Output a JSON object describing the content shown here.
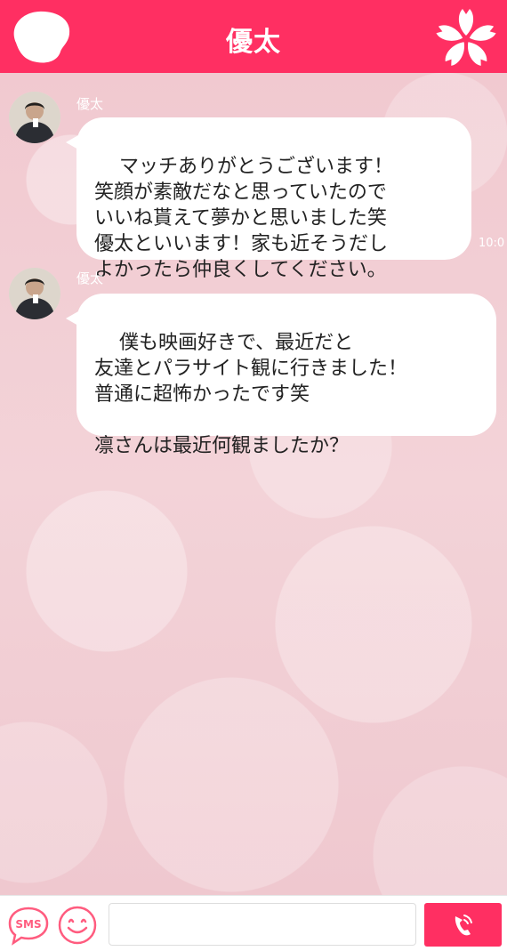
{
  "header": {
    "title": "優太",
    "back_icon": "blob-back-icon",
    "menu_icon": "sakura-flower-icon",
    "color": "#ff2f62"
  },
  "messages": [
    {
      "sender": "優太",
      "text": "マッチありがとうございます！\n笑顔が素敵だなと思っていたので\nいいね貰えて夢かと思いました笑\n優太といいます！家も近そうだし\nよかったら仲良くしてください。",
      "time": "10:0"
    },
    {
      "sender": "優太",
      "text": "僕も映画好きで、最近だと\n友達とパラサイト観に行きました！\n普通に超怖かったです笑\n\n凛さんは最近何観ましたか？",
      "time": ""
    }
  ],
  "footer": {
    "sms_label": "SMS",
    "emoji_icon": "smiley-icon",
    "input_value": "",
    "input_placeholder": "",
    "call_icon": "phone-icon"
  }
}
